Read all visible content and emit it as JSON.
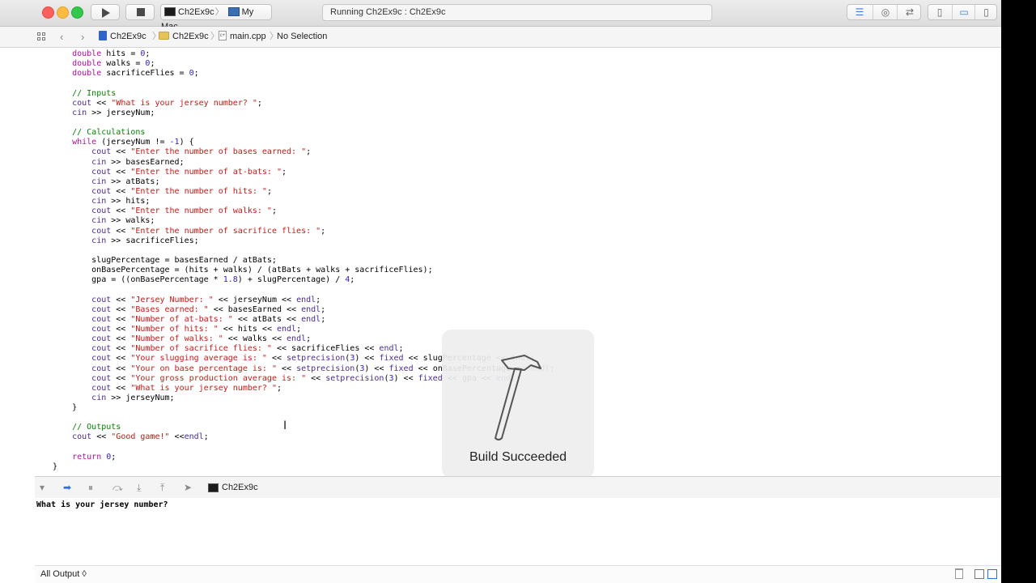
{
  "toolbar": {
    "scheme_target": "Ch2Ex9c",
    "scheme_device": "My Mac",
    "activity_text": "Running Ch2Ex9c : Ch2Ex9c"
  },
  "jumpbar": {
    "project": "Ch2Ex9c",
    "group": "Ch2Ex9c",
    "file": "main.cpp",
    "selection": "No Selection"
  },
  "editor": {
    "lines": [
      [
        {
          "t": "    ",
          "c": "p"
        },
        {
          "t": "double",
          "c": "k"
        },
        {
          "t": " hits = ",
          "c": "p"
        },
        {
          "t": "0",
          "c": "n"
        },
        {
          "t": ";",
          "c": "p"
        }
      ],
      [
        {
          "t": "    ",
          "c": "p"
        },
        {
          "t": "double",
          "c": "k"
        },
        {
          "t": " walks = ",
          "c": "p"
        },
        {
          "t": "0",
          "c": "n"
        },
        {
          "t": ";",
          "c": "p"
        }
      ],
      [
        {
          "t": "    ",
          "c": "p"
        },
        {
          "t": "double",
          "c": "k"
        },
        {
          "t": " sacrificeFlies = ",
          "c": "p"
        },
        {
          "t": "0",
          "c": "n"
        },
        {
          "t": ";",
          "c": "p"
        }
      ],
      [],
      [
        {
          "t": "    ",
          "c": "p"
        },
        {
          "t": "// Inputs",
          "c": "m"
        }
      ],
      [
        {
          "t": "    ",
          "c": "p"
        },
        {
          "t": "cout",
          "c": "f"
        },
        {
          "t": " << ",
          "c": "p"
        },
        {
          "t": "\"What is your jersey number? \"",
          "c": "s"
        },
        {
          "t": ";",
          "c": "p"
        }
      ],
      [
        {
          "t": "    ",
          "c": "p"
        },
        {
          "t": "cin",
          "c": "f"
        },
        {
          "t": " >> jerseyNum;",
          "c": "p"
        }
      ],
      [],
      [
        {
          "t": "    ",
          "c": "p"
        },
        {
          "t": "// Calculations",
          "c": "m"
        }
      ],
      [
        {
          "t": "    ",
          "c": "p"
        },
        {
          "t": "while",
          "c": "k"
        },
        {
          "t": " (jerseyNum != ",
          "c": "p"
        },
        {
          "t": "-1",
          "c": "n"
        },
        {
          "t": ") {",
          "c": "p"
        }
      ],
      [
        {
          "t": "        ",
          "c": "p"
        },
        {
          "t": "cout",
          "c": "f"
        },
        {
          "t": " << ",
          "c": "p"
        },
        {
          "t": "\"Enter the number of bases earned: \"",
          "c": "s"
        },
        {
          "t": ";",
          "c": "p"
        }
      ],
      [
        {
          "t": "        ",
          "c": "p"
        },
        {
          "t": "cin",
          "c": "f"
        },
        {
          "t": " >> basesEarned;",
          "c": "p"
        }
      ],
      [
        {
          "t": "        ",
          "c": "p"
        },
        {
          "t": "cout",
          "c": "f"
        },
        {
          "t": " << ",
          "c": "p"
        },
        {
          "t": "\"Enter the number of at-bats: \"",
          "c": "s"
        },
        {
          "t": ";",
          "c": "p"
        }
      ],
      [
        {
          "t": "        ",
          "c": "p"
        },
        {
          "t": "cin",
          "c": "f"
        },
        {
          "t": " >> atBats;",
          "c": "p"
        }
      ],
      [
        {
          "t": "        ",
          "c": "p"
        },
        {
          "t": "cout",
          "c": "f"
        },
        {
          "t": " << ",
          "c": "p"
        },
        {
          "t": "\"Enter the number of hits: \"",
          "c": "s"
        },
        {
          "t": ";",
          "c": "p"
        }
      ],
      [
        {
          "t": "        ",
          "c": "p"
        },
        {
          "t": "cin",
          "c": "f"
        },
        {
          "t": " >> hits;",
          "c": "p"
        }
      ],
      [
        {
          "t": "        ",
          "c": "p"
        },
        {
          "t": "cout",
          "c": "f"
        },
        {
          "t": " << ",
          "c": "p"
        },
        {
          "t": "\"Enter the number of walks: \"",
          "c": "s"
        },
        {
          "t": ";",
          "c": "p"
        }
      ],
      [
        {
          "t": "        ",
          "c": "p"
        },
        {
          "t": "cin",
          "c": "f"
        },
        {
          "t": " >> walks;",
          "c": "p"
        }
      ],
      [
        {
          "t": "        ",
          "c": "p"
        },
        {
          "t": "cout",
          "c": "f"
        },
        {
          "t": " << ",
          "c": "p"
        },
        {
          "t": "\"Enter the number of sacrifice flies: \"",
          "c": "s"
        },
        {
          "t": ";",
          "c": "p"
        }
      ],
      [
        {
          "t": "        ",
          "c": "p"
        },
        {
          "t": "cin",
          "c": "f"
        },
        {
          "t": " >> sacrificeFlies;",
          "c": "p"
        }
      ],
      [],
      [
        {
          "t": "        slugPercentage = basesEarned / atBats;",
          "c": "p"
        }
      ],
      [
        {
          "t": "        onBasePercentage = (hits + walks) / (atBats + walks + sacrificeFlies);",
          "c": "p"
        }
      ],
      [
        {
          "t": "        gpa = ((onBasePercentage * ",
          "c": "p"
        },
        {
          "t": "1.8",
          "c": "n"
        },
        {
          "t": ") + slugPercentage) / ",
          "c": "p"
        },
        {
          "t": "4",
          "c": "n"
        },
        {
          "t": ";",
          "c": "p"
        }
      ],
      [],
      [
        {
          "t": "        ",
          "c": "p"
        },
        {
          "t": "cout",
          "c": "f"
        },
        {
          "t": " << ",
          "c": "p"
        },
        {
          "t": "\"Jersey Number: \"",
          "c": "s"
        },
        {
          "t": " << jerseyNum << ",
          "c": "p"
        },
        {
          "t": "endl",
          "c": "f"
        },
        {
          "t": ";",
          "c": "p"
        }
      ],
      [
        {
          "t": "        ",
          "c": "p"
        },
        {
          "t": "cout",
          "c": "f"
        },
        {
          "t": " << ",
          "c": "p"
        },
        {
          "t": "\"Bases earned: \"",
          "c": "s"
        },
        {
          "t": " << basesEarned << ",
          "c": "p"
        },
        {
          "t": "endl",
          "c": "f"
        },
        {
          "t": ";",
          "c": "p"
        }
      ],
      [
        {
          "t": "        ",
          "c": "p"
        },
        {
          "t": "cout",
          "c": "f"
        },
        {
          "t": " << ",
          "c": "p"
        },
        {
          "t": "\"Number of at-bats: \"",
          "c": "s"
        },
        {
          "t": " << atBats << ",
          "c": "p"
        },
        {
          "t": "endl",
          "c": "f"
        },
        {
          "t": ";",
          "c": "p"
        }
      ],
      [
        {
          "t": "        ",
          "c": "p"
        },
        {
          "t": "cout",
          "c": "f"
        },
        {
          "t": " << ",
          "c": "p"
        },
        {
          "t": "\"Number of hits: \"",
          "c": "s"
        },
        {
          "t": " << hits << ",
          "c": "p"
        },
        {
          "t": "endl",
          "c": "f"
        },
        {
          "t": ";",
          "c": "p"
        }
      ],
      [
        {
          "t": "        ",
          "c": "p"
        },
        {
          "t": "cout",
          "c": "f"
        },
        {
          "t": " << ",
          "c": "p"
        },
        {
          "t": "\"Number of walks: \"",
          "c": "s"
        },
        {
          "t": " << walks << ",
          "c": "p"
        },
        {
          "t": "endl",
          "c": "f"
        },
        {
          "t": ";",
          "c": "p"
        }
      ],
      [
        {
          "t": "        ",
          "c": "p"
        },
        {
          "t": "cout",
          "c": "f"
        },
        {
          "t": " << ",
          "c": "p"
        },
        {
          "t": "\"Number of sacrifice flies: \"",
          "c": "s"
        },
        {
          "t": " << sacrificeFlies << ",
          "c": "p"
        },
        {
          "t": "endl",
          "c": "f"
        },
        {
          "t": ";",
          "c": "p"
        }
      ],
      [
        {
          "t": "        ",
          "c": "p"
        },
        {
          "t": "cout",
          "c": "f"
        },
        {
          "t": " << ",
          "c": "p"
        },
        {
          "t": "\"Your slugging average is: \"",
          "c": "s"
        },
        {
          "t": " << ",
          "c": "p"
        },
        {
          "t": "setprecision",
          "c": "f"
        },
        {
          "t": "(",
          "c": "p"
        },
        {
          "t": "3",
          "c": "n"
        },
        {
          "t": ") << ",
          "c": "p"
        },
        {
          "t": "fixed",
          "c": "f"
        },
        {
          "t": " << slugPercentage << ",
          "c": "p"
        },
        {
          "t": "endl",
          "c": "f"
        },
        {
          "t": ";",
          "c": "p"
        }
      ],
      [
        {
          "t": "        ",
          "c": "p"
        },
        {
          "t": "cout",
          "c": "f"
        },
        {
          "t": " << ",
          "c": "p"
        },
        {
          "t": "\"Your on base percentage is: \"",
          "c": "s"
        },
        {
          "t": " << ",
          "c": "p"
        },
        {
          "t": "setprecision",
          "c": "f"
        },
        {
          "t": "(",
          "c": "p"
        },
        {
          "t": "3",
          "c": "n"
        },
        {
          "t": ") << ",
          "c": "p"
        },
        {
          "t": "fixed",
          "c": "f"
        },
        {
          "t": " << onBasePercentage << ",
          "c": "p"
        },
        {
          "t": "endl",
          "c": "f"
        },
        {
          "t": ";",
          "c": "p"
        }
      ],
      [
        {
          "t": "        ",
          "c": "p"
        },
        {
          "t": "cout",
          "c": "f"
        },
        {
          "t": " << ",
          "c": "p"
        },
        {
          "t": "\"Your gross production average is: \"",
          "c": "s"
        },
        {
          "t": " << ",
          "c": "p"
        },
        {
          "t": "setprecision",
          "c": "f"
        },
        {
          "t": "(",
          "c": "p"
        },
        {
          "t": "3",
          "c": "n"
        },
        {
          "t": ") << ",
          "c": "p"
        },
        {
          "t": "fixed",
          "c": "f"
        },
        {
          "t": " << gpa << ",
          "c": "p"
        },
        {
          "t": "endl",
          "c": "f"
        },
        {
          "t": ";",
          "c": "p"
        }
      ],
      [
        {
          "t": "        ",
          "c": "p"
        },
        {
          "t": "cout",
          "c": "f"
        },
        {
          "t": " << ",
          "c": "p"
        },
        {
          "t": "\"What is your jersey number? \"",
          "c": "s"
        },
        {
          "t": ";",
          "c": "p"
        }
      ],
      [
        {
          "t": "        ",
          "c": "p"
        },
        {
          "t": "cin",
          "c": "f"
        },
        {
          "t": " >> jerseyNum;",
          "c": "p"
        }
      ],
      [
        {
          "t": "    }",
          "c": "p"
        }
      ],
      [],
      [
        {
          "t": "    ",
          "c": "p"
        },
        {
          "t": "// Outputs",
          "c": "m"
        }
      ],
      [
        {
          "t": "    ",
          "c": "p"
        },
        {
          "t": "cout",
          "c": "f"
        },
        {
          "t": " << ",
          "c": "p"
        },
        {
          "t": "\"Good game!\"",
          "c": "s"
        },
        {
          "t": " <<",
          "c": "p"
        },
        {
          "t": "endl",
          "c": "f"
        },
        {
          "t": ";",
          "c": "p"
        }
      ],
      [],
      [
        {
          "t": "    ",
          "c": "p"
        },
        {
          "t": "return",
          "c": "k"
        },
        {
          "t": " ",
          "c": "p"
        },
        {
          "t": "0",
          "c": "n"
        },
        {
          "t": ";",
          "c": "p"
        }
      ],
      [
        {
          "t": "}",
          "c": "p"
        }
      ]
    ]
  },
  "syntax_colors": {
    "p": "#000000",
    "k": "#b0109a",
    "n": "#2c1dd1",
    "s": "#c41a16",
    "m": "#008400",
    "f": "#4a2a96"
  },
  "hud": {
    "text": "Build Succeeded",
    "icon": "hammer-icon"
  },
  "debugbar": {
    "process": "Ch2Ex9c"
  },
  "console": {
    "output": "What is your jersey number?"
  },
  "bottombar": {
    "filter": "All Output ◊"
  }
}
